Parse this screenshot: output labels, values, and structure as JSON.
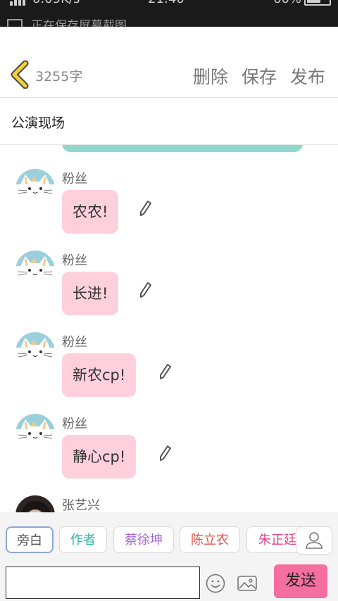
{
  "status_bar": {
    "network_speed": "0.09K/s",
    "time": "21:40",
    "battery": "60%",
    "notification": "正在保存屏幕截图"
  },
  "header": {
    "word_count": "3255字",
    "delete_label": "删除",
    "save_label": "保存",
    "publish_label": "发布"
  },
  "title": "公演现场",
  "messages": [
    {
      "sender": "粉丝",
      "text": "农农!"
    },
    {
      "sender": "粉丝",
      "text": "长进!"
    },
    {
      "sender": "粉丝",
      "text": "新农cp!"
    },
    {
      "sender": "粉丝",
      "text": "静心cp!"
    },
    {
      "sender": "张艺兴",
      "text": ""
    }
  ],
  "roles": [
    {
      "label": "旁白",
      "color": "#555555"
    },
    {
      "label": "作者",
      "color": "#2bb5a8"
    },
    {
      "label": "蔡徐坤",
      "color": "#a36bd6"
    },
    {
      "label": "陈立农",
      "color": "#e0564a"
    },
    {
      "label": "朱正廷",
      "color": "#e0468a"
    }
  ],
  "input": {
    "value": "",
    "send_label": "发送"
  },
  "colors": {
    "bubble": "#fdd0dc",
    "send_button": "#f46fa0",
    "accent_back": "#f2d23a"
  }
}
